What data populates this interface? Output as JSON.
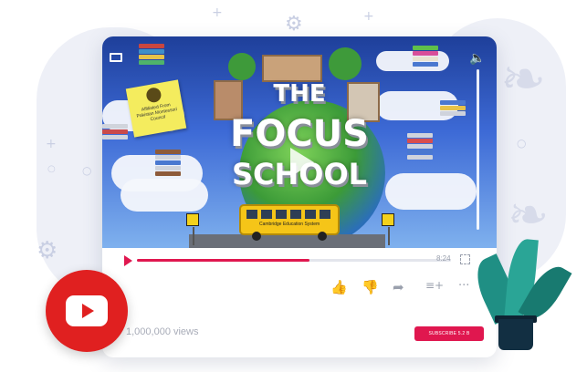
{
  "video": {
    "title_lines": [
      "THE",
      "FOCUS",
      "SCHOOL"
    ],
    "badge_text": "Affiliated From Pakistan Montessori Council",
    "bus_text": "Cambridge Education System"
  },
  "player": {
    "progress": 0.55,
    "time": "8:24",
    "controls": {
      "screen_icon": "screen-cast-icon",
      "volume_icon": "volume-icon",
      "fullscreen_icon": "fullscreen-icon"
    }
  },
  "actions": [
    {
      "name": "like",
      "icon": "thumbs-up-icon",
      "glyph": "👍",
      "color": "#e0174f"
    },
    {
      "name": "dislike",
      "icon": "thumbs-down-icon",
      "glyph": "👎",
      "color": "#9aa0ad"
    },
    {
      "name": "share",
      "icon": "share-icon",
      "glyph": "➦",
      "color": "#9aa0ad"
    },
    {
      "name": "add-to-playlist",
      "icon": "playlist-add-icon",
      "glyph": "≡+",
      "color": "#9aa0ad"
    },
    {
      "name": "more",
      "icon": "more-icon",
      "glyph": "···",
      "color": "#9aa0ad"
    }
  ],
  "meta": {
    "views": "1,000,000 views",
    "subscribe_label": "SUBSCRIBE 5.2 B"
  },
  "colors": {
    "accent": "#e0174f",
    "youtube_red": "#e02020",
    "card_bg": "#ffffff"
  }
}
